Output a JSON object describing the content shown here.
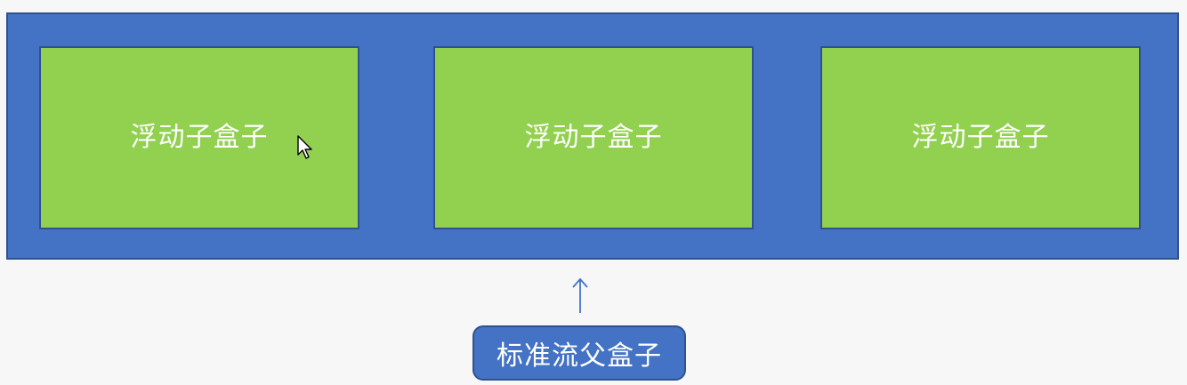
{
  "parent": {
    "fill_color": "#4472c4",
    "border_color": "#2f528f"
  },
  "children": [
    {
      "label": "浮动子盒子"
    },
    {
      "label": "浮动子盒子"
    },
    {
      "label": "浮动子盒子"
    }
  ],
  "child_fill_color": "#92d050",
  "annotation": {
    "label": "标准流父盒子",
    "arrow_icon": "up-arrow-icon"
  },
  "cursor_icon": "mouse-pointer-icon"
}
